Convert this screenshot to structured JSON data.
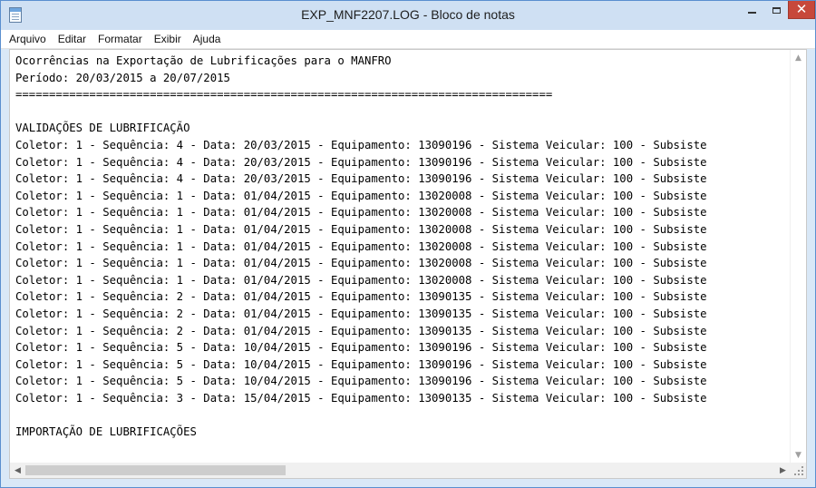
{
  "window": {
    "title": "EXP_MNF2207.LOG - Bloco de notas",
    "icon": "notepad-icon",
    "controls": {
      "minimize": "minimize-icon",
      "maximize": "maximize-icon",
      "close": "✕"
    }
  },
  "menu": {
    "items": [
      "Arquivo",
      "Editar",
      "Formatar",
      "Exibir",
      "Ajuda"
    ]
  },
  "document": {
    "lines": [
      "Ocorrências na Exportação de Lubrificações para o MANFRO",
      "Período: 20/03/2015 a 20/07/2015",
      "================================================================================",
      "",
      "VALIDAÇÕES DE LUBRIFICAÇÃO",
      "Coletor: 1 - Sequência: 4 - Data: 20/03/2015 - Equipamento: 13090196 - Sistema Veicular: 100 - Subsiste",
      "Coletor: 1 - Sequência: 4 - Data: 20/03/2015 - Equipamento: 13090196 - Sistema Veicular: 100 - Subsiste",
      "Coletor: 1 - Sequência: 4 - Data: 20/03/2015 - Equipamento: 13090196 - Sistema Veicular: 100 - Subsiste",
      "Coletor: 1 - Sequência: 1 - Data: 01/04/2015 - Equipamento: 13020008 - Sistema Veicular: 100 - Subsiste",
      "Coletor: 1 - Sequência: 1 - Data: 01/04/2015 - Equipamento: 13020008 - Sistema Veicular: 100 - Subsiste",
      "Coletor: 1 - Sequência: 1 - Data: 01/04/2015 - Equipamento: 13020008 - Sistema Veicular: 100 - Subsiste",
      "Coletor: 1 - Sequência: 1 - Data: 01/04/2015 - Equipamento: 13020008 - Sistema Veicular: 100 - Subsiste",
      "Coletor: 1 - Sequência: 1 - Data: 01/04/2015 - Equipamento: 13020008 - Sistema Veicular: 100 - Subsiste",
      "Coletor: 1 - Sequência: 1 - Data: 01/04/2015 - Equipamento: 13020008 - Sistema Veicular: 100 - Subsiste",
      "Coletor: 1 - Sequência: 2 - Data: 01/04/2015 - Equipamento: 13090135 - Sistema Veicular: 100 - Subsiste",
      "Coletor: 1 - Sequência: 2 - Data: 01/04/2015 - Equipamento: 13090135 - Sistema Veicular: 100 - Subsiste",
      "Coletor: 1 - Sequência: 2 - Data: 01/04/2015 - Equipamento: 13090135 - Sistema Veicular: 100 - Subsiste",
      "Coletor: 1 - Sequência: 5 - Data: 10/04/2015 - Equipamento: 13090196 - Sistema Veicular: 100 - Subsiste",
      "Coletor: 1 - Sequência: 5 - Data: 10/04/2015 - Equipamento: 13090196 - Sistema Veicular: 100 - Subsiste",
      "Coletor: 1 - Sequência: 5 - Data: 10/04/2015 - Equipamento: 13090196 - Sistema Veicular: 100 - Subsiste",
      "Coletor: 1 - Sequência: 3 - Data: 15/04/2015 - Equipamento: 13090135 - Sistema Veicular: 100 - Subsiste",
      "",
      "IMPORTAÇÃO DE LUBRIFICAÇÕES"
    ]
  },
  "scrollbars": {
    "vertical": {
      "up": "▲",
      "down": "▼"
    },
    "horizontal": {
      "left": "◀",
      "right": "▶"
    }
  }
}
